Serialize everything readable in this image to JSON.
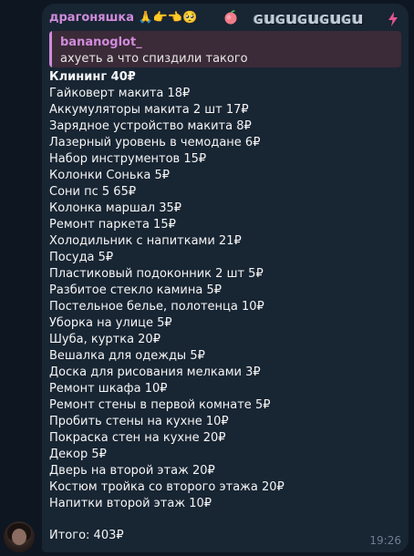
{
  "message": {
    "author": "драгоняшка",
    "author_emojis": "🙏👉👈🥺",
    "status_emoji": "🍑",
    "author_tag": "ɢuɢuɢuɢuɢu",
    "reply": {
      "name": "bananoglot_",
      "text": "ахуеть а что спиздили такого"
    },
    "lines": [
      "Клининг 40₽",
      "Гайковерт макита 18₽",
      "Аккумуляторы макита 2 шт 17₽",
      "Зарядное устройство макита 8₽",
      "Лазерный уровень в чемодане 6₽",
      "Набор инструментов 15₽",
      "Колонки Сонька 5₽",
      "Сони пс 5 65₽",
      "Колонка маршал 35₽",
      "Ремонт паркета 15₽",
      "Холодильник с напитками 21₽",
      "Посуда 5₽",
      "Пластиковый подоконник 2 шт 5₽",
      "Разбитое стекло камина 5₽",
      "Постельное белье, полотенца 10₽",
      "Уборка на улице 5₽",
      "Шуба, куртка 20₽",
      "Вешалка для одежды 5₽",
      "Доска для рисования мелками 3₽",
      "Ремонт шкафа 10₽",
      "Ремонт стены в первой комнате 5₽",
      "Пробить стены на кухне 10₽",
      "Покраска стен на кухне 20₽",
      "Декор 5₽",
      "Дверь на второй этаж 20₽",
      "Костюм тройка со второго этажа 20₽",
      "Напитки второй этаж 10₽"
    ],
    "total": "Итого: 403₽",
    "time": "19:26"
  },
  "colors": {
    "background": "#0e1621",
    "bubble": "#182533",
    "author": "#d08bdb",
    "reply_bg": "#3b2a37",
    "time": "#6d7f8f"
  },
  "icons": {
    "avatar": "user-avatar",
    "status": "peach-icon",
    "boost": "lightning-icon"
  }
}
